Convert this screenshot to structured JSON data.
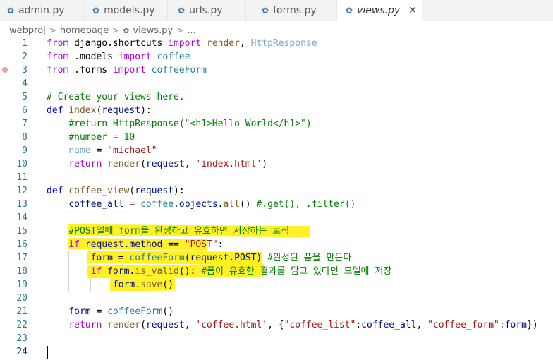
{
  "tabs": [
    {
      "label": "admin.py",
      "active": false
    },
    {
      "label": "models.py",
      "active": false
    },
    {
      "label": "urls.py",
      "active": false
    },
    {
      "label": "forms.py",
      "active": false
    },
    {
      "label": "views.py",
      "active": true
    }
  ],
  "close_glyph": "✕",
  "breadcrumb": {
    "parts": [
      "webproj",
      "homepage",
      "views.py",
      "..."
    ]
  },
  "editor": {
    "current_line": 24,
    "breakpoint_line": 3,
    "lines": [
      [
        [
          "kw",
          "from"
        ],
        [
          "plain",
          " django.shortcuts "
        ],
        [
          "kw",
          "import"
        ],
        [
          "plain",
          " "
        ],
        [
          "fn",
          "render"
        ],
        [
          "plain",
          ", "
        ],
        [
          "inactive",
          "HttpResponse"
        ]
      ],
      [
        [
          "kw",
          "from"
        ],
        [
          "plain",
          " ."
        ],
        [
          "plain",
          "models "
        ],
        [
          "kw",
          "import"
        ],
        [
          "plain",
          " "
        ],
        [
          "cls",
          "coffee"
        ]
      ],
      [
        [
          "kw",
          "from"
        ],
        [
          "plain",
          " ."
        ],
        [
          "plain",
          "forms "
        ],
        [
          "kw",
          "import"
        ],
        [
          "plain",
          " "
        ],
        [
          "cls",
          "coffeeForm"
        ]
      ],
      [],
      [
        [
          "cmt",
          "# Create your views here."
        ]
      ],
      [
        [
          "kw2",
          "def"
        ],
        [
          "plain",
          " "
        ],
        [
          "fn",
          "index"
        ],
        [
          "plain",
          "("
        ],
        [
          "var",
          "request"
        ],
        [
          "plain",
          "):"
        ]
      ],
      [
        [
          "plain",
          "    "
        ],
        [
          "cmt",
          "#return HttpResponse(\"<h1>Hello World</h1>\")"
        ]
      ],
      [
        [
          "plain",
          "    "
        ],
        [
          "cmt",
          "#number = 10"
        ]
      ],
      [
        [
          "plain",
          "    "
        ],
        [
          "inactive",
          "name"
        ],
        [
          "plain",
          " = "
        ],
        [
          "str",
          "\"michael\""
        ]
      ],
      [
        [
          "plain",
          "    "
        ],
        [
          "kw",
          "return"
        ],
        [
          "plain",
          " "
        ],
        [
          "fn",
          "render"
        ],
        [
          "plain",
          "("
        ],
        [
          "var",
          "request"
        ],
        [
          "plain",
          ", "
        ],
        [
          "str",
          "'index.html'"
        ],
        [
          "plain",
          ")"
        ]
      ],
      [],
      [
        [
          "kw2",
          "def"
        ],
        [
          "plain",
          " "
        ],
        [
          "fn",
          "coffee_view"
        ],
        [
          "plain",
          "("
        ],
        [
          "var",
          "request"
        ],
        [
          "plain",
          "):"
        ]
      ],
      [
        [
          "plain",
          "    "
        ],
        [
          "var",
          "coffee_all"
        ],
        [
          "plain",
          " = "
        ],
        [
          "cls",
          "coffee"
        ],
        [
          "plain",
          "."
        ],
        [
          "var",
          "objects"
        ],
        [
          "plain",
          "."
        ],
        [
          "fn",
          "all"
        ],
        [
          "plain",
          "() "
        ],
        [
          "cmt",
          "#.get(), .filter()"
        ]
      ],
      [],
      [
        [
          "plain",
          "    "
        ],
        [
          "cmt",
          "#POST일때 form을 완성하고 유효하면 저장하는 로직"
        ]
      ],
      [
        [
          "plain",
          "    "
        ],
        [
          "kw",
          "if"
        ],
        [
          "plain",
          " "
        ],
        [
          "var",
          "request"
        ],
        [
          "plain",
          "."
        ],
        [
          "var",
          "method"
        ],
        [
          "plain",
          " == "
        ],
        [
          "str",
          "\"POST\""
        ],
        [
          "plain",
          ":"
        ]
      ],
      [
        [
          "plain",
          "        "
        ],
        [
          "var",
          "form"
        ],
        [
          "plain",
          " = "
        ],
        [
          "cls",
          "coffeeForm"
        ],
        [
          "plain",
          "("
        ],
        [
          "var",
          "request"
        ],
        [
          "plain",
          "."
        ],
        [
          "var",
          "POST"
        ],
        [
          "plain",
          ") "
        ],
        [
          "cmt",
          "#완성된 폼을 만든다"
        ]
      ],
      [
        [
          "plain",
          "        "
        ],
        [
          "kw",
          "if"
        ],
        [
          "plain",
          " "
        ],
        [
          "var",
          "form"
        ],
        [
          "plain",
          "."
        ],
        [
          "fn",
          "is_valid"
        ],
        [
          "plain",
          "(): "
        ],
        [
          "cmt",
          "#폼이 유효한 결과를 담고 있다면 모델에 저장"
        ]
      ],
      [
        [
          "plain",
          "            "
        ],
        [
          "var",
          "form"
        ],
        [
          "plain",
          "."
        ],
        [
          "fn",
          "save"
        ],
        [
          "plain",
          "()"
        ]
      ],
      [],
      [
        [
          "plain",
          "    "
        ],
        [
          "var",
          "form"
        ],
        [
          "plain",
          " = "
        ],
        [
          "cls",
          "coffeeForm"
        ],
        [
          "plain",
          "()"
        ]
      ],
      [
        [
          "plain",
          "    "
        ],
        [
          "kw",
          "return"
        ],
        [
          "plain",
          " "
        ],
        [
          "fn",
          "render"
        ],
        [
          "plain",
          "("
        ],
        [
          "var",
          "request"
        ],
        [
          "plain",
          ", "
        ],
        [
          "str",
          "'coffee.html'"
        ],
        [
          "plain",
          ", {"
        ],
        [
          "str",
          "\"coffee_list\""
        ],
        [
          "plain",
          ":"
        ],
        [
          "var",
          "coffee_all"
        ],
        [
          "plain",
          ", "
        ],
        [
          "str",
          "\"coffee_form\""
        ],
        [
          "plain",
          ":"
        ],
        [
          "var",
          "form"
        ],
        [
          "plain",
          "})"
        ]
      ],
      [],
      []
    ]
  }
}
